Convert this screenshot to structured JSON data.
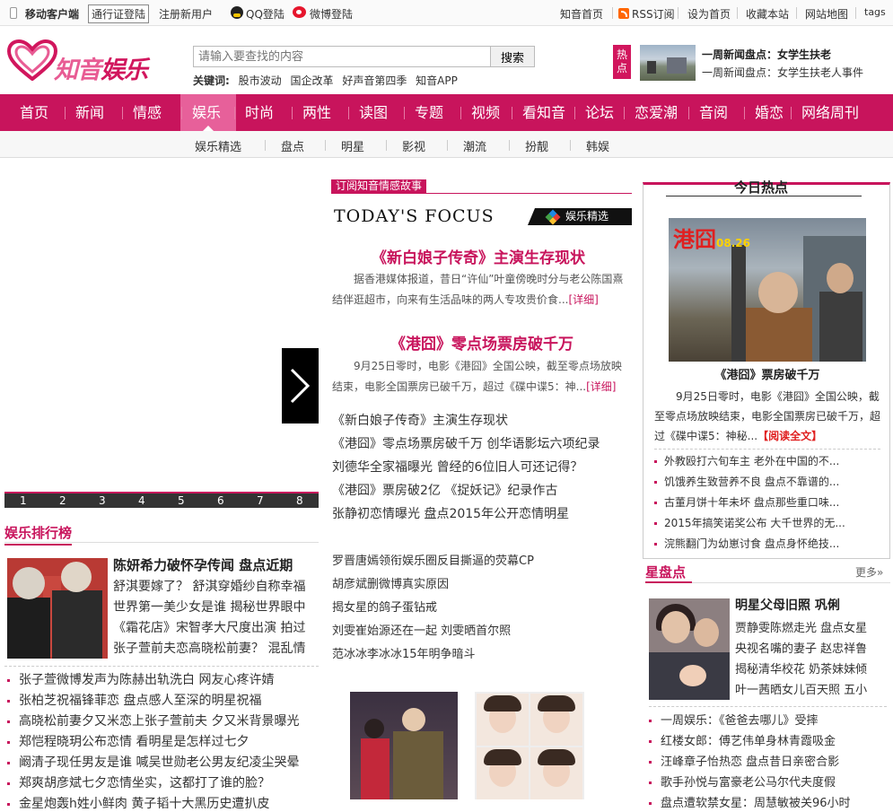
{
  "topbar": {
    "mobile": "移动客户端",
    "passport_login": "通行证登陆",
    "register": "注册新用户",
    "qq_login": "QQ登陆",
    "weibo_login": "微博登陆",
    "links": [
      "知音首页",
      "RSS订阅",
      "设为首页",
      "收藏本站",
      "网站地图",
      "tags"
    ]
  },
  "header": {
    "logo_main": "知音",
    "logo_sub": "娱乐",
    "search_placeholder": "请输入要查找的内容",
    "search_button": "搜索",
    "keywords_label": "关键词:",
    "keywords": [
      "股市波动",
      "国企改革",
      "好声音第四季",
      "知音APP"
    ],
    "hot_badge": "热点",
    "hot_title": "一周新闻盘点：女学生扶老",
    "hot_sub": "一周新闻盘点：女学生扶老人事件"
  },
  "nav": {
    "items": [
      "首页",
      "新闻",
      "情感",
      "娱乐",
      "时尚",
      "两性",
      "读图",
      "专题",
      "视频",
      "看知音",
      "论坛",
      "恋爱潮",
      "音阅",
      "婚恋",
      "网络周刊"
    ],
    "sub": [
      "娱乐精选",
      "盘点",
      "明星",
      "影视",
      "潮流",
      "扮靓",
      "韩娱"
    ]
  },
  "slider": {
    "pages": [
      "1",
      "2",
      "3",
      "4",
      "5",
      "6",
      "7",
      "8"
    ]
  },
  "ranking": {
    "title": "娱乐排行榜",
    "headline": "陈妍希力破怀孕传闻 盘点近期",
    "subs": [
      "舒淇要嫁了？ 舒淇穿婚纱自称幸福",
      "世界第一美少女是谁 揭秘世界眼中",
      "《霜花店》宋智孝大尺度出演 拍过",
      "张子萱前夫恋高晓松前妻？ 混乱情"
    ],
    "list": [
      "张子萱微博发声为陈赫出轨洗白 网友心疼许婧",
      "张柏芝祝福锋菲恋 盘点感人至深的明星祝福",
      "高晓松前妻夕又米恋上张子萱前夫 夕又米背景曝光",
      "郑恺程晓玥公布恋情 看明星是怎样过七夕",
      "阚清子现任男友是谁 喊吴世勋老公男友纪凌尘哭晕",
      "郑爽胡彦斌七夕恋情坐实，这都打了谁的脸？",
      "金星炮轰h姓小鲜肉 黄子韬十大黑历史遭扒皮"
    ]
  },
  "focus": {
    "tag": "订阅知音情感故事",
    "heading": "TODAY'S  FOCUS",
    "tab": "娱乐精选",
    "articles": [
      {
        "title": "《新白娘子传奇》主演生存现状",
        "body": "据香港媒体报道，昔日“许仙”叶童傍晚时分与老公陈国熹结伴逛超市，向来有生活品味的两人专攻贵价食...",
        "more": "[详细]"
      },
      {
        "title": "《港囧》零点场票房破千万",
        "body": "9月25日零时，电影《港囧》全国公映，截至零点场放映结束，电影全国票房已破千万，超过《碟中谍5：神...",
        "more": "[详细]"
      }
    ],
    "list": [
      "《新白娘子传奇》主演生存现状",
      "《港囧》零点场票房破千万 创华语影坛六项纪录",
      "刘德华全家福曝光 曾经的6位旧人可还记得？",
      "《港囧》票房破2亿 《捉妖记》纪录作古",
      "张静初恋情曝光 盘点2015年公开恋情明星"
    ],
    "list2": [
      "罗晋唐嫣领衔娱乐圈反目撕逼的荧幕CP",
      "胡彦斌删微博真实原因",
      "揭女星的鸽子蛋钻戒",
      "刘雯崔始源还在一起 刘雯晒首尔照",
      "范冰冰李冰冰15年明争暗斗"
    ]
  },
  "hot_today": {
    "title": "今日热点",
    "poster_title": "港囧",
    "poster_date": "08.26",
    "caption": "《港囧》票房破千万",
    "body": "9月25日零时，电影《港囧》全国公映，截至零点场放映结束，电影全国票房已破千万，超过《碟中谍5：神秘...",
    "more": "【阅读全文】",
    "list": [
      "外教殴打六旬车主 老外在中国的不...",
      "饥饿养生致营养不良 盘点不靠谱的...",
      "古董月饼十年未坏 盘点那些重口味...",
      "2015年搞笑诺奖公布 大千世界的无...",
      "浣熊翻门为幼崽讨食 盘点身怀绝技..."
    ]
  },
  "star": {
    "title": "星盘点",
    "more": "更多»",
    "headline": "明星父母旧照 巩俐",
    "subs": [
      "贾静雯陈燃走光 盘点女星",
      "央视名嘴的妻子 赵忠祥鲁",
      "揭秘清华校花 奶茶妹妹倾",
      "叶一茜晒女儿百天照 五小"
    ],
    "list": [
      "一周娱乐：《爸爸去哪儿》受摔",
      "红楼女郎：傅艺伟单身林青霞吸金",
      "汪峰章子怡热恋 盘点昔日亲密合影",
      "歌手孙悦与富豪老公马尔代夫度假",
      "盘点遭软禁女星：周慧敏被关96小时"
    ]
  },
  "colors": {
    "brand": "#c8145c",
    "nav_active": "#e7609a"
  }
}
